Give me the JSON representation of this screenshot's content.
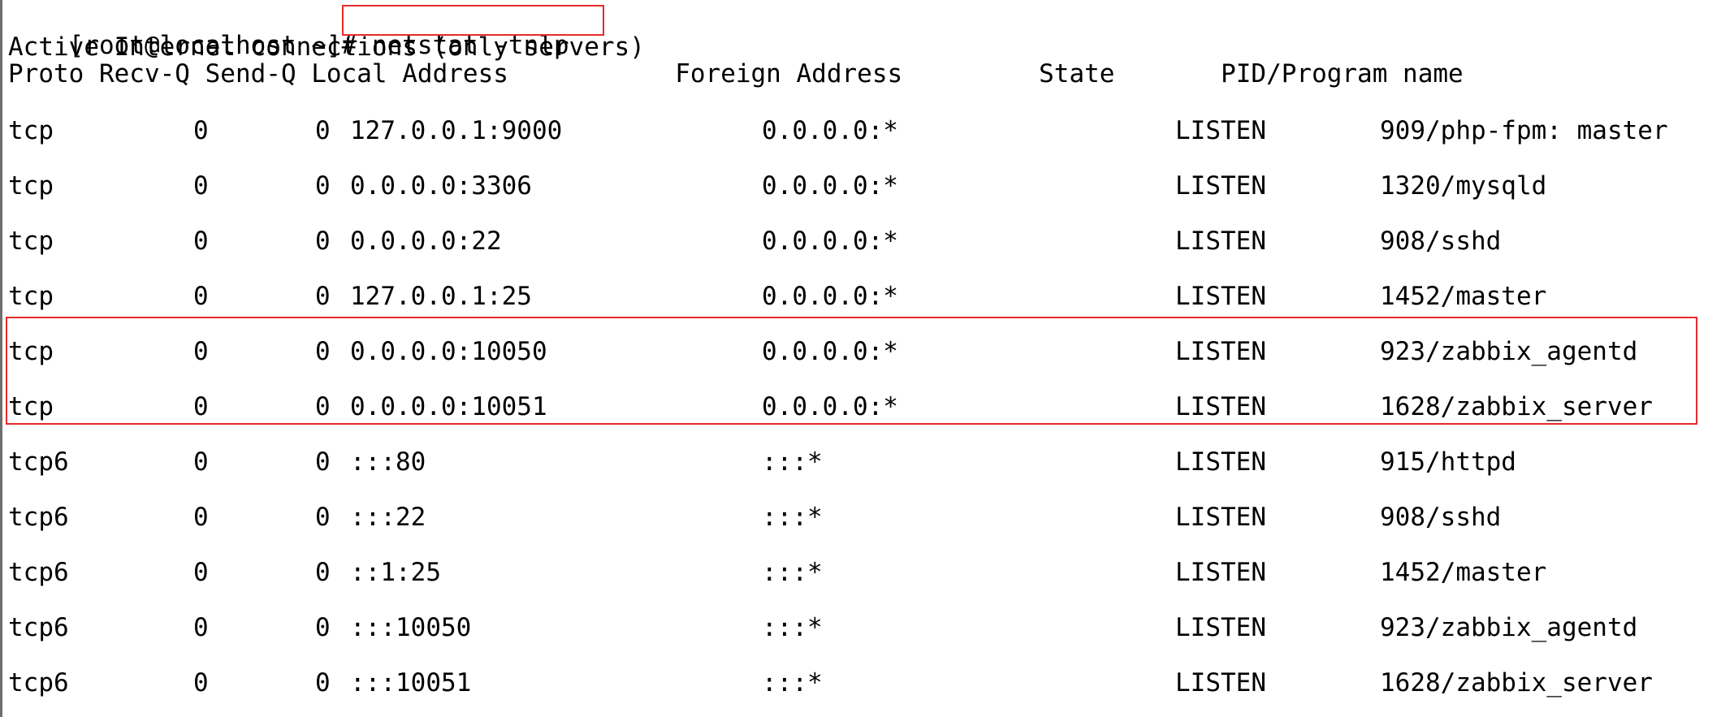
{
  "terminal": {
    "prompt": "[root@localhost ~]# ",
    "command": "netstat -tnlp",
    "status": "Active Internet connections (only servers)",
    "header": "Proto Recv-Q Send-Q Local Address           Foreign Address         State       PID/Program name",
    "rows": [
      {
        "proto": "tcp",
        "recv_q": "0",
        "send_q": "0",
        "local_address": "127.0.0.1:9000",
        "foreign_address": "0.0.0.0:*",
        "state": "LISTEN",
        "pid_program": "909/php-fpm: master"
      },
      {
        "proto": "tcp",
        "recv_q": "0",
        "send_q": "0",
        "local_address": "0.0.0.0:3306",
        "foreign_address": "0.0.0.0:*",
        "state": "LISTEN",
        "pid_program": "1320/mysqld"
      },
      {
        "proto": "tcp",
        "recv_q": "0",
        "send_q": "0",
        "local_address": "0.0.0.0:22",
        "foreign_address": "0.0.0.0:*",
        "state": "LISTEN",
        "pid_program": "908/sshd"
      },
      {
        "proto": "tcp",
        "recv_q": "0",
        "send_q": "0",
        "local_address": "127.0.0.1:25",
        "foreign_address": "0.0.0.0:*",
        "state": "LISTEN",
        "pid_program": "1452/master"
      },
      {
        "proto": "tcp",
        "recv_q": "0",
        "send_q": "0",
        "local_address": "0.0.0.0:10050",
        "foreign_address": "0.0.0.0:*",
        "state": "LISTEN",
        "pid_program": "923/zabbix_agentd"
      },
      {
        "proto": "tcp",
        "recv_q": "0",
        "send_q": "0",
        "local_address": "0.0.0.0:10051",
        "foreign_address": "0.0.0.0:*",
        "state": "LISTEN",
        "pid_program": "1628/zabbix_server"
      },
      {
        "proto": "tcp6",
        "recv_q": "0",
        "send_q": "0",
        "local_address": ":::80",
        "foreign_address": ":::*",
        "state": "LISTEN",
        "pid_program": "915/httpd"
      },
      {
        "proto": "tcp6",
        "recv_q": "0",
        "send_q": "0",
        "local_address": ":::22",
        "foreign_address": ":::*",
        "state": "LISTEN",
        "pid_program": "908/sshd"
      },
      {
        "proto": "tcp6",
        "recv_q": "0",
        "send_q": "0",
        "local_address": "::1:25",
        "foreign_address": ":::*",
        "state": "LISTEN",
        "pid_program": "1452/master"
      },
      {
        "proto": "tcp6",
        "recv_q": "0",
        "send_q": "0",
        "local_address": ":::10050",
        "foreign_address": ":::*",
        "state": "LISTEN",
        "pid_program": "923/zabbix_agentd"
      },
      {
        "proto": "tcp6",
        "recv_q": "0",
        "send_q": "0",
        "local_address": ":::10051",
        "foreign_address": ":::*",
        "state": "LISTEN",
        "pid_program": "1628/zabbix_server"
      }
    ]
  },
  "colors": {
    "background": "#ffffff",
    "text": "#000000",
    "highlight_border": "#e62a2a",
    "left_edge": "#6f6f6f"
  }
}
